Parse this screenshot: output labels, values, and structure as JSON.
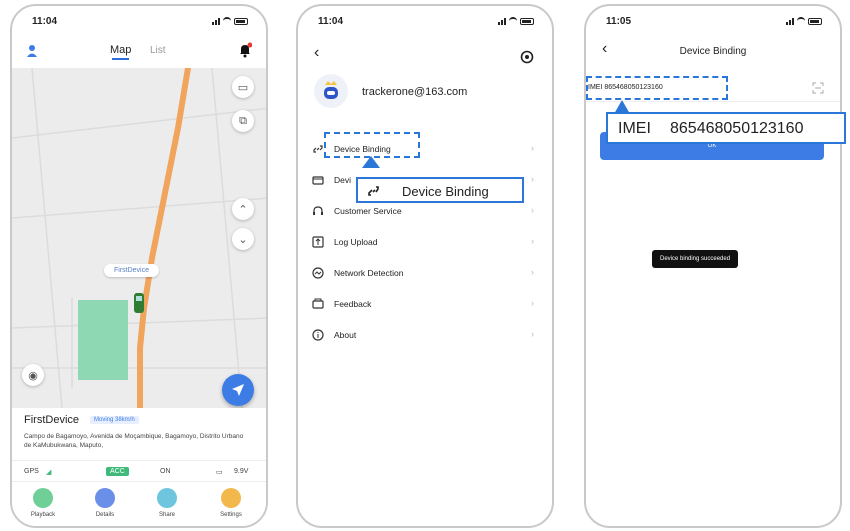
{
  "colors": {
    "accent": "#3d7ce5",
    "callout_border": "#2b77d8",
    "route": "#f0a45c",
    "zone": "#8ed9b3",
    "acc_badge": "#3fba7a"
  },
  "screen1": {
    "time": "11:04",
    "tabs": {
      "map": "Map",
      "list": "List"
    },
    "map_label": "FirstDevice",
    "device_name": "FirstDevice",
    "status_badge": "Moving 38km/h",
    "address": "Campo de Bagamoyo, Avenida de Moçambique, Bagamoyo, Distrito Urbano de KaMubukwana, Maputo,",
    "stats": {
      "gps": "GPS",
      "acc": "ACC",
      "on": "ON",
      "voltage": "9.9V"
    },
    "bottom_nav": [
      "Playback",
      "Details",
      "Share",
      "Settings"
    ]
  },
  "screen2": {
    "time": "11:04",
    "email": "trackerone@163.com",
    "menu": [
      "Device Binding",
      "Devi",
      "Customer Service",
      "Log Upload",
      "Network Detection",
      "Feedback",
      "About"
    ],
    "callout": "Device Binding"
  },
  "screen3": {
    "time": "11:05",
    "title": "Device Binding",
    "imei_small": "IMEI  865468050123160",
    "imei_label": "IMEI",
    "imei_value": "865468050123160",
    "button_text": "OK",
    "toast": "Device binding succeeded"
  }
}
